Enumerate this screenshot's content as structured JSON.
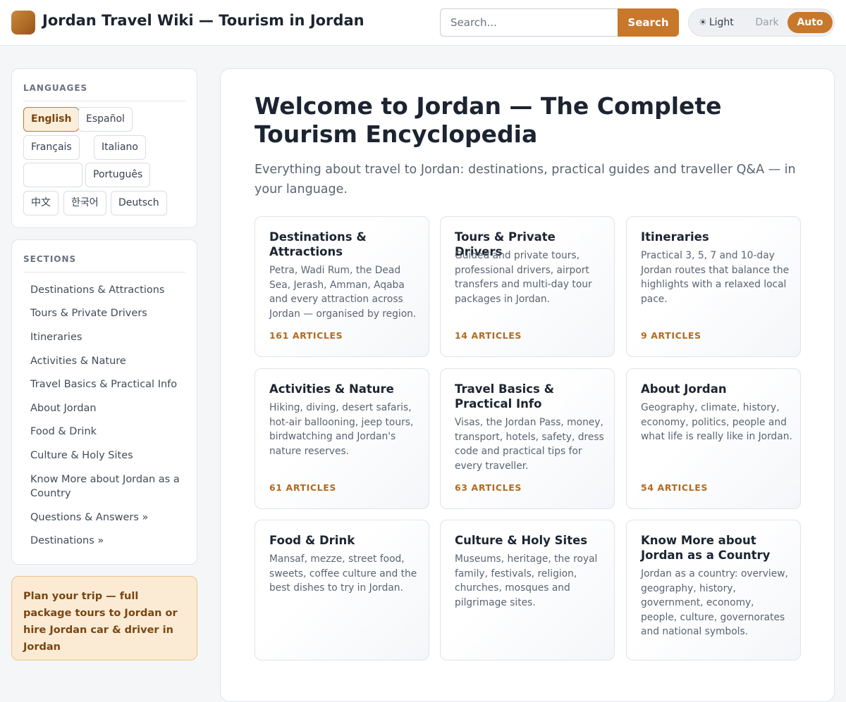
{
  "header": {
    "title": "Jordan Travel Wiki — Tourism in Jordan",
    "search_placeholder": "Search...",
    "search_button": "Search",
    "theme": {
      "light": "Light",
      "dark": "Dark",
      "auto": "Auto",
      "selected": "Auto"
    }
  },
  "languages": {
    "title": "LANGUAGES",
    "items": [
      {
        "label": "English",
        "active": true
      },
      {
        "label": "Español"
      },
      {
        "label": "Français"
      },
      {
        "label": "Italiano"
      },
      {
        "label": ""
      },
      {
        "label": "Português"
      },
      {
        "label": "中文"
      },
      {
        "label": "한국어"
      },
      {
        "label": "Deutsch"
      }
    ]
  },
  "sections": {
    "title": "SECTIONS",
    "items": [
      "Destinations & Attractions",
      "Tours & Private Drivers",
      "Itineraries",
      "Activities & Nature",
      "Travel Basics & Practical Info",
      "About Jordan",
      "Food & Drink",
      "Culture & Holy Sites",
      "Know More about Jordan as a Country",
      "Questions & Answers »",
      "Destinations »"
    ]
  },
  "promo": {
    "text": "Plan your trip — full package tours to Jordan or hire Jordan car & driver in Jordan"
  },
  "main": {
    "title": "Welcome to Jordan — The Complete Tourism Encyclopedia",
    "lead": "Everything about travel to Jordan: destinations, practical guides and traveller Q&A — in your language.",
    "cards": [
      {
        "title": "Destinations & Attractions",
        "desc": "Petra, Wadi Rum, the Dead Sea, Jerash, Amman, Aqaba and every attraction across Jordan — organised by region.",
        "count": "161 ARTICLES"
      },
      {
        "title": "Tours & Private Drivers",
        "desc": "Guided and private tours, professional drivers, airport transfers and multi-day tour packages in Jordan.",
        "count": "14 ARTICLES"
      },
      {
        "title": "Itineraries",
        "desc": "Practical 3, 5, 7 and 10-day Jordan routes that balance the highlights with a relaxed local pace.",
        "count": "9 ARTICLES"
      },
      {
        "title": "Activities & Nature",
        "desc": "Hiking, diving, desert safaris, hot-air ballooning, jeep tours, birdwatching and Jordan's nature reserves.",
        "count": "61 ARTICLES"
      },
      {
        "title": "Travel Basics & Practical Info",
        "desc": "Visas, the Jordan Pass, money, transport, hotels, safety, dress code and practical tips for every traveller.",
        "count": "63 ARTICLES"
      },
      {
        "title": "About Jordan",
        "desc": "Geography, climate, history, economy, politics, people and what life is really like in Jordan.",
        "count": "54 ARTICLES"
      },
      {
        "title": "Food & Drink",
        "desc": "Mansaf, mezze, street food, sweets, coffee culture and the best dishes to try in Jordan.",
        "count": ""
      },
      {
        "title": "Culture & Holy Sites",
        "desc": "Museums, heritage, the royal family, festivals, religion, churches, mosques and pilgrimage sites.",
        "count": ""
      },
      {
        "title": "Know More about Jordan as a Country",
        "desc": "Jordan as a country: overview, geography, history, government, economy, people, culture, governorates and national symbols.",
        "count": ""
      }
    ]
  }
}
